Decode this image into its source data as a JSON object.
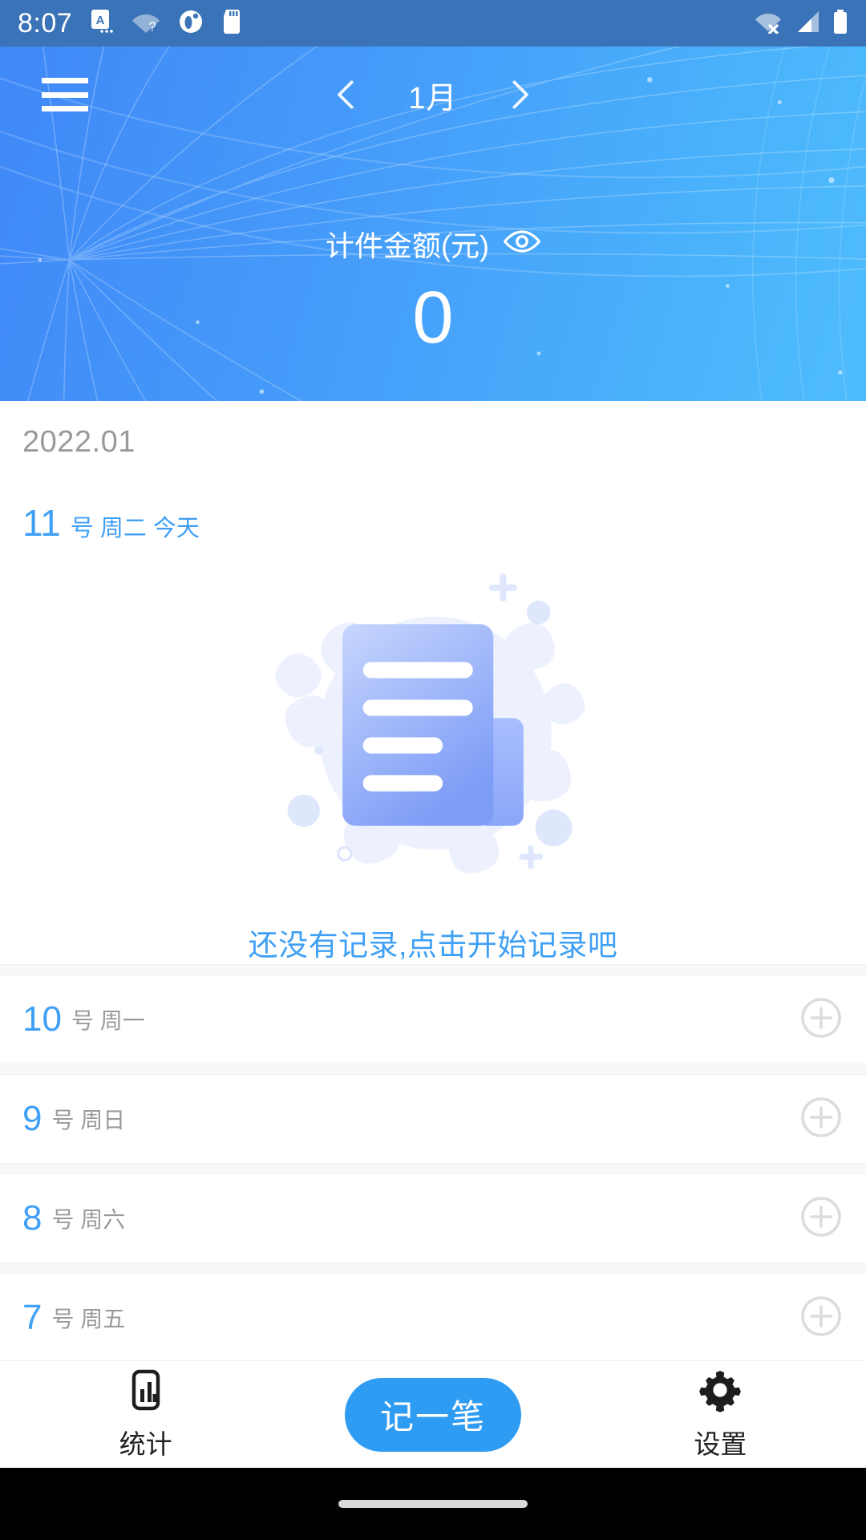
{
  "status_bar": {
    "time": "8:07",
    "left_icons": [
      "ime-a-icon",
      "wifi-question-icon",
      "circle-badge-icon",
      "sd-card-icon"
    ],
    "right_icons": [
      "wifi-off-icon",
      "cellular-signal-icon",
      "battery-full-icon"
    ],
    "background_color": "#3a73b8"
  },
  "header": {
    "menu_icon": "hamburger-menu-icon",
    "prev_icon": "chevron-left-icon",
    "next_icon": "chevron-right-icon",
    "month_label": "1月",
    "amount_label": "计件金额(元)",
    "visibility_icon": "eye-icon",
    "amount_value": "0",
    "gradient_from": "#3f86f7",
    "gradient_to": "#50c0fc"
  },
  "content": {
    "year_month": "2022.01",
    "today": {
      "day": "11",
      "suffix": "号 周二 今天"
    },
    "empty_state": {
      "illustration": "empty-document-illustration",
      "text": "还没有记录,点击开始记录吧",
      "text_color": "#3fa0f5"
    },
    "days": [
      {
        "day": "10",
        "suffix": "号 周一",
        "add_icon": "plus-circle-icon"
      },
      {
        "day": "9",
        "suffix": "号 周日",
        "add_icon": "plus-circle-icon"
      },
      {
        "day": "8",
        "suffix": "号 周六",
        "add_icon": "plus-circle-icon"
      },
      {
        "day": "7",
        "suffix": "号 周五",
        "add_icon": "plus-circle-icon"
      }
    ]
  },
  "bottom_nav": {
    "stats": {
      "label": "统计",
      "icon": "bar-chart-icon"
    },
    "record": {
      "label": "记一笔",
      "color": "#2f9cf4"
    },
    "settings": {
      "label": "设置",
      "icon": "gear-icon"
    }
  }
}
